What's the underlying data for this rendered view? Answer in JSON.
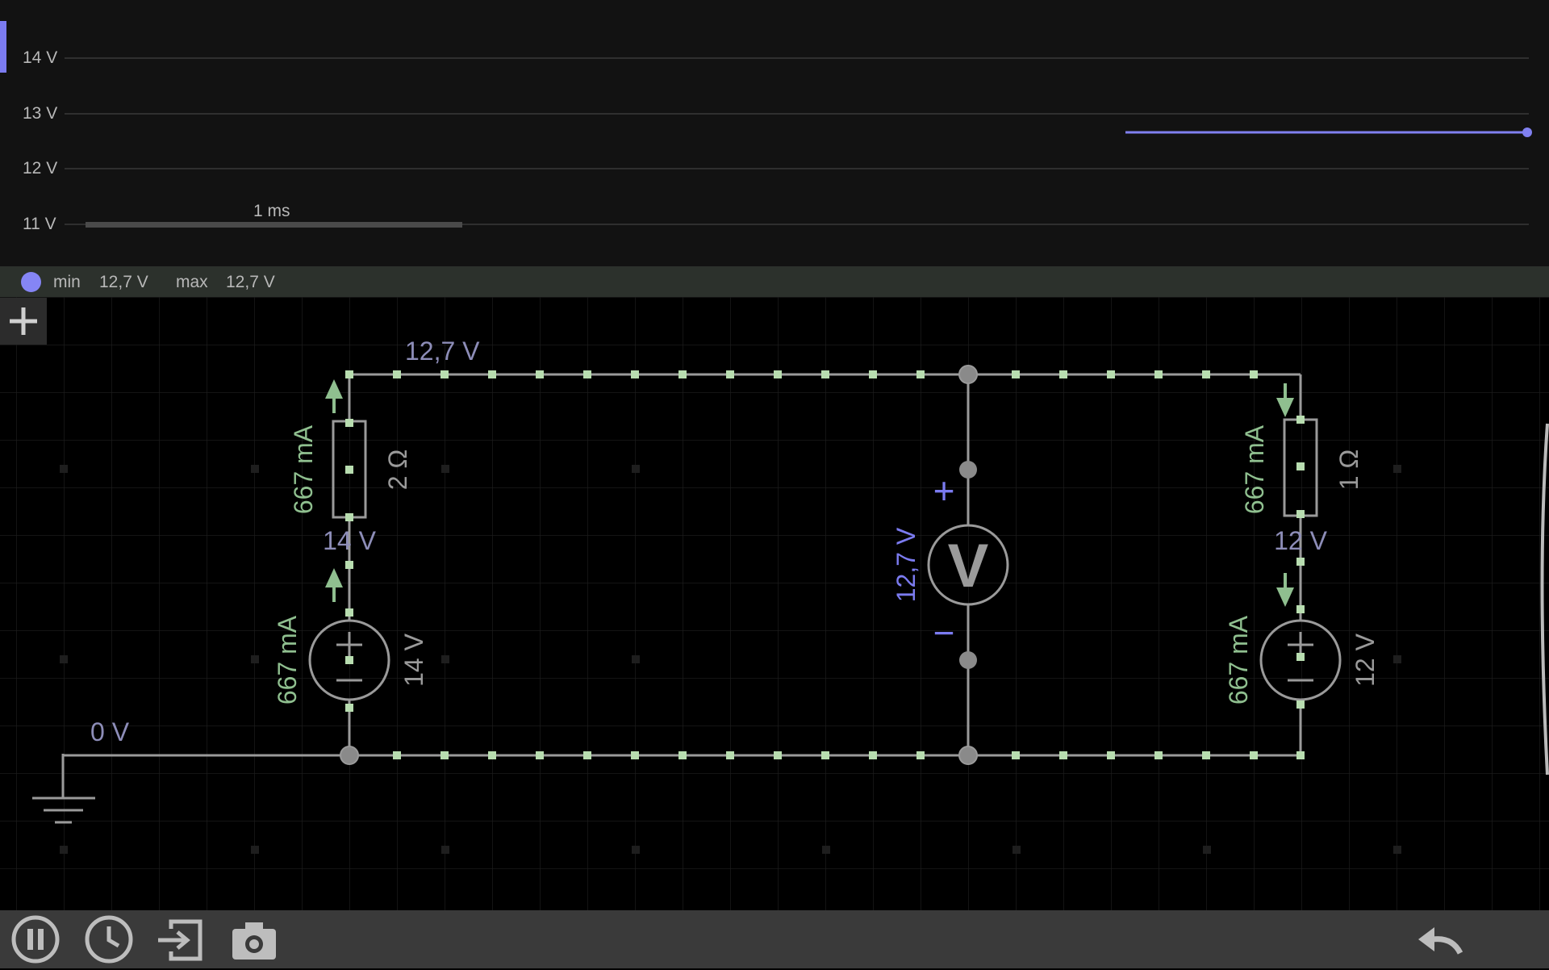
{
  "scope": {
    "y_axis_labels": [
      "14 V",
      "13 V",
      "12 V",
      "11 V"
    ],
    "timescale_label": "1 ms",
    "trace_value": "12,7 V",
    "trace_color": "#8080f0"
  },
  "scope_info": {
    "min_label": "min",
    "min_value": "12,7 V",
    "max_label": "max",
    "max_value": "12,7 V"
  },
  "circuit": {
    "top_node_voltage": "12,7 V",
    "ground_voltage": "0 V",
    "left_resistor": {
      "current": "667 mA",
      "resistance": "2 Ω"
    },
    "left_node_voltage": "14 V",
    "left_source": {
      "current": "667 mA",
      "voltage": "14 V"
    },
    "voltmeter": {
      "reading": "12,7 V",
      "plus": "+",
      "minus": "−",
      "symbol": "V"
    },
    "right_resistor": {
      "current": "667 mA",
      "resistance": "1 Ω"
    },
    "right_node_voltage": "12 V",
    "right_source": {
      "current": "667 mA",
      "voltage": "12 V"
    },
    "colors": {
      "wire": "#9a9a9a",
      "current": "#8fbf8f",
      "voltage_label": "#8d8db8",
      "meter": "#7b7bf0"
    }
  },
  "toolbar": {
    "icons": [
      "pause-icon",
      "clock-icon",
      "import-icon",
      "camera-icon",
      "undo-icon"
    ]
  }
}
